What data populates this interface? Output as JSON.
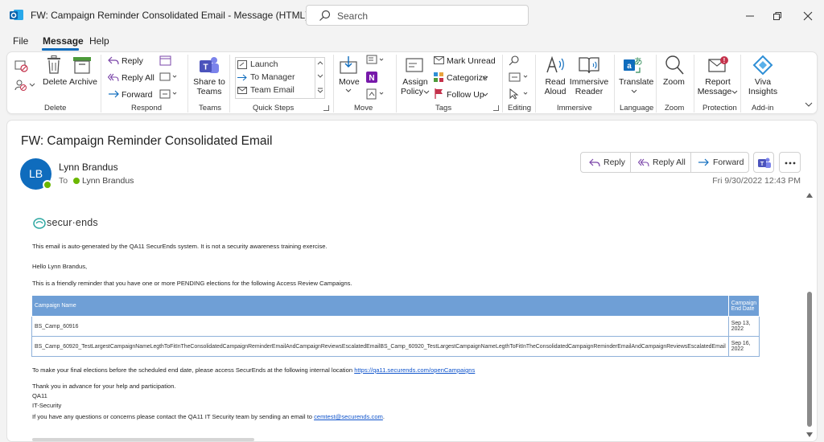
{
  "window": {
    "title": "FW: Campaign Reminder Consolidated Email  -  Message (HTML)",
    "search_placeholder": "Search"
  },
  "menu_tabs": [
    "File",
    "Message",
    "Help"
  ],
  "ribbon": {
    "delete_group": {
      "delete": "Delete",
      "archive": "Archive",
      "label": "Delete"
    },
    "respond_group": {
      "reply": "Reply",
      "reply_all": "Reply All",
      "forward": "Forward",
      "label": "Respond"
    },
    "teams_group": {
      "share_line1": "Share to",
      "share_line2": "Teams",
      "label": "Teams"
    },
    "quick_steps": {
      "items": [
        "Launch",
        "To Manager",
        "Team Email"
      ],
      "label": "Quick Steps"
    },
    "move_group": {
      "move": "Move",
      "label": "Move"
    },
    "tags_group": {
      "assign_line1": "Assign",
      "assign_line2": "Policy",
      "mark_unread": "Mark Unread",
      "categorize": "Categorize",
      "follow_up": "Follow Up",
      "label": "Tags"
    },
    "editing_group": {
      "label": "Editing"
    },
    "immersive_group": {
      "read_line1": "Read",
      "read_line2": "Aloud",
      "reader_line1": "Immersive",
      "reader_line2": "Reader",
      "label": "Immersive"
    },
    "language_group": {
      "translate": "Translate",
      "label": "Language"
    },
    "zoom_group": {
      "zoom": "Zoom",
      "label": "Zoom"
    },
    "protection_group": {
      "report_line1": "Report",
      "report_line2": "Message",
      "label": "Protection"
    },
    "addin_group": {
      "viva_line1": "Viva",
      "viva_line2": "Insights",
      "label": "Add-in"
    }
  },
  "message": {
    "subject": "FW: Campaign Reminder Consolidated Email",
    "sender_initials": "LB",
    "sender": "Lynn Brandus",
    "to_label": "To",
    "to_name": "Lynn Brandus",
    "date": "Fri 9/30/2022 12:43 PM",
    "actions": {
      "reply": "Reply",
      "reply_all": "Reply All",
      "forward": "Forward"
    }
  },
  "body": {
    "logo_text": "secur·ends",
    "auto_generated": "This email is auto-generated by the QA11 SecurEnds system. It is not a security awareness training exercise.",
    "greeting": "Hello Lynn Brandus,",
    "intro": "This is a friendly reminder that you have one or more PENDING elections for the following Access Review Campaigns.",
    "table": {
      "headers": [
        "Campaign Name",
        "Campaign End Date"
      ],
      "rows": [
        [
          "BS_Camp_60916",
          "Sep 13, 2022"
        ],
        [
          "BS_Camp_60920_TestLargestCampaignNameLegthToFitInTheConsolidatedCampaignReminderEmailAndCampaignReviewsEscalatedEmailBS_Camp_60920_TestLargestCampaignNameLegthToFitInTheConsolidatedCampaignReminderEmailAndCampaignReviewsEscalatedEmail",
          "Sep 16, 2022"
        ]
      ]
    },
    "final_elections": "To make your final elections before the scheduled end date, please access SecurEnds at the following internal location ",
    "final_link": "https://qa11.securends.com/openCampaigns",
    "thanks": "Thank you in advance for your help and participation.",
    "sig1": "QA11",
    "sig2": "IT-Security",
    "contact": "If you have any questions or concerns please contact the QA11 IT Security team by sending an email to ",
    "contact_email": "cemtest@securends.com",
    "contact_end": "."
  },
  "colors": {
    "accent": "#0f6cbd",
    "table_header": "#6f9fd6",
    "presence": "#6bb700"
  }
}
